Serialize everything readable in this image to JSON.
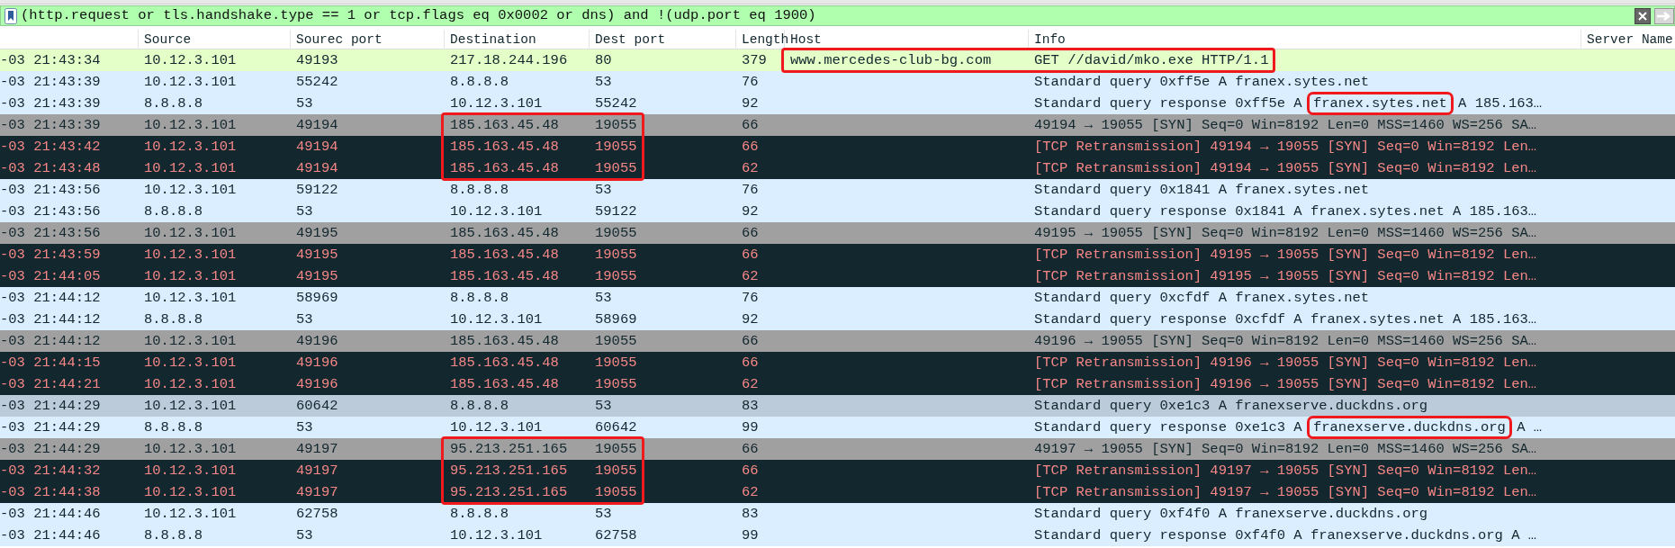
{
  "filter": {
    "value": "(http.request or tls.handshake.type == 1 or tcp.flags eq 0x0002 or dns) and !(udp.port eq 1900)"
  },
  "columns": [
    null,
    "Source",
    "Sourec port",
    "Destination",
    "Dest port",
    "Length",
    "Host",
    "Info",
    "Server Name"
  ],
  "rows": [
    {
      "kind": "http",
      "selected": false,
      "host_info_boxed": true,
      "dest_boxed": false,
      "time": "-03 21:43:34",
      "source": "10.12.3.101",
      "source_port": "49193",
      "destination": "217.18.244.196",
      "dest_port": "80",
      "length": "379",
      "host": "www.mercedes-club-bg.com",
      "info": "GET //david/mko.exe HTTP/1.1"
    },
    {
      "kind": "dns",
      "selected": false,
      "host_info_boxed": false,
      "dest_boxed": false,
      "time": "-03 21:43:39",
      "source": "10.12.3.101",
      "source_port": "55242",
      "destination": "8.8.8.8",
      "dest_port": "53",
      "length": "76",
      "info": "Standard query 0xff5e A franex.sytes.net"
    },
    {
      "kind": "dns",
      "selected": false,
      "host_info_boxed": false,
      "dest_boxed": false,
      "time": "-03 21:43:39",
      "source": "8.8.8.8",
      "source_port": "53",
      "destination": "10.12.3.101",
      "dest_port": "55242",
      "length": "92",
      "info": [
        {
          "text": "Standard query response 0xff5e A ",
          "boxed": false
        },
        {
          "text": "franex.sytes.net",
          "boxed": true
        },
        {
          "text": " A 185.163…",
          "boxed": false
        }
      ]
    },
    {
      "kind": "syn",
      "selected": false,
      "host_info_boxed": false,
      "dest_boxed": true,
      "time": "-03 21:43:39",
      "source": "10.12.3.101",
      "source_port": "49194",
      "destination": "185.163.45.48",
      "dest_port": "19055",
      "length": "66",
      "info": "49194 → 19055 [SYN] Seq=0 Win=8192 Len=0 MSS=1460 WS=256 SA…"
    },
    {
      "kind": "retransmission",
      "selected": false,
      "host_info_boxed": false,
      "dest_boxed": true,
      "time": "-03 21:43:42",
      "source": "10.12.3.101",
      "source_port": "49194",
      "destination": "185.163.45.48",
      "dest_port": "19055",
      "length": "66",
      "info": "[TCP Retransmission] 49194 → 19055 [SYN] Seq=0 Win=8192 Len…"
    },
    {
      "kind": "retransmission",
      "selected": false,
      "host_info_boxed": false,
      "dest_boxed": true,
      "time": "-03 21:43:48",
      "source": "10.12.3.101",
      "source_port": "49194",
      "destination": "185.163.45.48",
      "dest_port": "19055",
      "length": "62",
      "info": "[TCP Retransmission] 49194 → 19055 [SYN] Seq=0 Win=8192 Len…"
    },
    {
      "kind": "dns",
      "selected": false,
      "host_info_boxed": false,
      "dest_boxed": false,
      "time": "-03 21:43:56",
      "source": "10.12.3.101",
      "source_port": "59122",
      "destination": "8.8.8.8",
      "dest_port": "53",
      "length": "76",
      "info": "Standard query 0x1841 A franex.sytes.net"
    },
    {
      "kind": "dns",
      "selected": false,
      "host_info_boxed": false,
      "dest_boxed": false,
      "time": "-03 21:43:56",
      "source": "8.8.8.8",
      "source_port": "53",
      "destination": "10.12.3.101",
      "dest_port": "59122",
      "length": "92",
      "info": "Standard query response 0x1841 A franex.sytes.net A 185.163…"
    },
    {
      "kind": "syn",
      "selected": false,
      "host_info_boxed": false,
      "dest_boxed": false,
      "time": "-03 21:43:56",
      "source": "10.12.3.101",
      "source_port": "49195",
      "destination": "185.163.45.48",
      "dest_port": "19055",
      "length": "66",
      "info": "49195 → 19055 [SYN] Seq=0 Win=8192 Len=0 MSS=1460 WS=256 SA…"
    },
    {
      "kind": "retransmission",
      "selected": false,
      "host_info_boxed": false,
      "dest_boxed": false,
      "time": "-03 21:43:59",
      "source": "10.12.3.101",
      "source_port": "49195",
      "destination": "185.163.45.48",
      "dest_port": "19055",
      "length": "66",
      "info": "[TCP Retransmission] 49195 → 19055 [SYN] Seq=0 Win=8192 Len…"
    },
    {
      "kind": "retransmission",
      "selected": false,
      "host_info_boxed": false,
      "dest_boxed": false,
      "time": "-03 21:44:05",
      "source": "10.12.3.101",
      "source_port": "49195",
      "destination": "185.163.45.48",
      "dest_port": "19055",
      "length": "62",
      "info": "[TCP Retransmission] 49195 → 19055 [SYN] Seq=0 Win=8192 Len…"
    },
    {
      "kind": "dns",
      "selected": false,
      "host_info_boxed": false,
      "dest_boxed": false,
      "time": "-03 21:44:12",
      "source": "10.12.3.101",
      "source_port": "58969",
      "destination": "8.8.8.8",
      "dest_port": "53",
      "length": "76",
      "info": "Standard query 0xcfdf A franex.sytes.net"
    },
    {
      "kind": "dns",
      "selected": false,
      "host_info_boxed": false,
      "dest_boxed": false,
      "time": "-03 21:44:12",
      "source": "8.8.8.8",
      "source_port": "53",
      "destination": "10.12.3.101",
      "dest_port": "58969",
      "length": "92",
      "info": "Standard query response 0xcfdf A franex.sytes.net A 185.163…"
    },
    {
      "kind": "syn",
      "selected": false,
      "host_info_boxed": false,
      "dest_boxed": false,
      "time": "-03 21:44:12",
      "source": "10.12.3.101",
      "source_port": "49196",
      "destination": "185.163.45.48",
      "dest_port": "19055",
      "length": "66",
      "info": "49196 → 19055 [SYN] Seq=0 Win=8192 Len=0 MSS=1460 WS=256 SA…"
    },
    {
      "kind": "retransmission",
      "selected": false,
      "host_info_boxed": false,
      "dest_boxed": false,
      "time": "-03 21:44:15",
      "source": "10.12.3.101",
      "source_port": "49196",
      "destination": "185.163.45.48",
      "dest_port": "19055",
      "length": "66",
      "info": "[TCP Retransmission] 49196 → 19055 [SYN] Seq=0 Win=8192 Len…"
    },
    {
      "kind": "retransmission",
      "selected": false,
      "host_info_boxed": false,
      "dest_boxed": false,
      "time": "-03 21:44:21",
      "source": "10.12.3.101",
      "source_port": "49196",
      "destination": "185.163.45.48",
      "dest_port": "19055",
      "length": "62",
      "info": "[TCP Retransmission] 49196 → 19055 [SYN] Seq=0 Win=8192 Len…"
    },
    {
      "kind": "dns",
      "selected": true,
      "host_info_boxed": false,
      "dest_boxed": false,
      "time": "-03 21:44:29",
      "source": "10.12.3.101",
      "source_port": "60642",
      "destination": "8.8.8.8",
      "dest_port": "53",
      "length": "83",
      "info": "Standard query 0xe1c3 A franexserve.duckdns.org"
    },
    {
      "kind": "dns",
      "selected": false,
      "host_info_boxed": false,
      "dest_boxed": false,
      "time": "-03 21:44:29",
      "source": "8.8.8.8",
      "source_port": "53",
      "destination": "10.12.3.101",
      "dest_port": "60642",
      "length": "99",
      "info": [
        {
          "text": "Standard query response 0xe1c3 A ",
          "boxed": false
        },
        {
          "text": "franexserve.duckdns.org",
          "boxed": true
        },
        {
          "text": " A …",
          "boxed": false
        }
      ]
    },
    {
      "kind": "syn",
      "selected": false,
      "host_info_boxed": false,
      "dest_boxed": true,
      "time": "-03 21:44:29",
      "source": "10.12.3.101",
      "source_port": "49197",
      "destination": "95.213.251.165",
      "dest_port": "19055",
      "length": "66",
      "info": "49197 → 19055 [SYN] Seq=0 Win=8192 Len=0 MSS=1460 WS=256 SA…"
    },
    {
      "kind": "retransmission",
      "selected": false,
      "host_info_boxed": false,
      "dest_boxed": true,
      "time": "-03 21:44:32",
      "source": "10.12.3.101",
      "source_port": "49197",
      "destination": "95.213.251.165",
      "dest_port": "19055",
      "length": "66",
      "info": "[TCP Retransmission] 49197 → 19055 [SYN] Seq=0 Win=8192 Len…"
    },
    {
      "kind": "retransmission",
      "selected": false,
      "host_info_boxed": false,
      "dest_boxed": true,
      "time": "-03 21:44:38",
      "source": "10.12.3.101",
      "source_port": "49197",
      "destination": "95.213.251.165",
      "dest_port": "19055",
      "length": "62",
      "info": "[TCP Retransmission] 49197 → 19055 [SYN] Seq=0 Win=8192 Len…"
    },
    {
      "kind": "dns",
      "selected": false,
      "host_info_boxed": false,
      "dest_boxed": false,
      "time": "-03 21:44:46",
      "source": "10.12.3.101",
      "source_port": "62758",
      "destination": "8.8.8.8",
      "dest_port": "53",
      "length": "83",
      "info": "Standard query 0xf4f0 A franexserve.duckdns.org"
    },
    {
      "kind": "dns",
      "selected": false,
      "host_info_boxed": false,
      "dest_boxed": false,
      "time": "-03 21:44:46",
      "source": "8.8.8.8",
      "source_port": "53",
      "destination": "10.12.3.101",
      "dest_port": "62758",
      "length": "99",
      "info": "Standard query response 0xf4f0 A franexserve.duckdns.org A …"
    }
  ]
}
